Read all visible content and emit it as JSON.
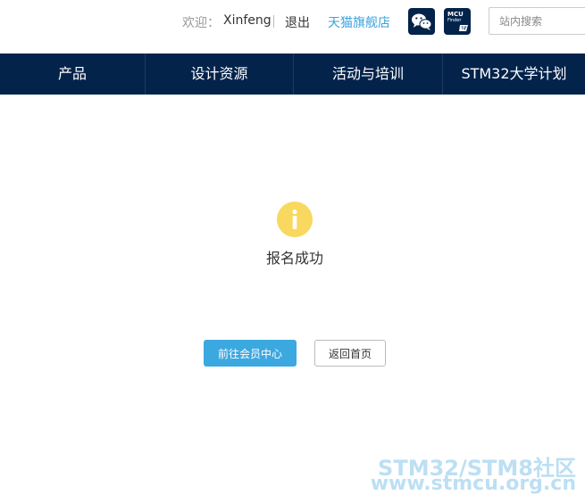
{
  "header": {
    "welcome_label": "欢迎：",
    "username": "Xinfeng",
    "logout_label": "退出",
    "tmall_label": "天猫旗舰店",
    "wechat_icon": "wechat-icon",
    "mcu_finder": {
      "line1": "MCU",
      "line2": "Finder",
      "logo_icon": "st-logo-icon"
    },
    "search_placeholder": "站内搜索"
  },
  "nav": {
    "items": [
      {
        "label": "产品"
      },
      {
        "label": "设计资源"
      },
      {
        "label": "活动与培训"
      },
      {
        "label": "STM32大学计划"
      }
    ]
  },
  "main": {
    "status_icon": "info-icon",
    "message": "报名成功",
    "primary_button": "前往会员中心",
    "secondary_button": "返回首页"
  },
  "watermark": {
    "line1": "STM32/STM8社区",
    "line2": "www.stmcu.org.cn"
  },
  "colors": {
    "nav_bg": "#03234b",
    "link": "#3aa3dd",
    "primary": "#3ca8e0",
    "info_icon": "#f9d860",
    "watermark": "#bcdff3"
  }
}
